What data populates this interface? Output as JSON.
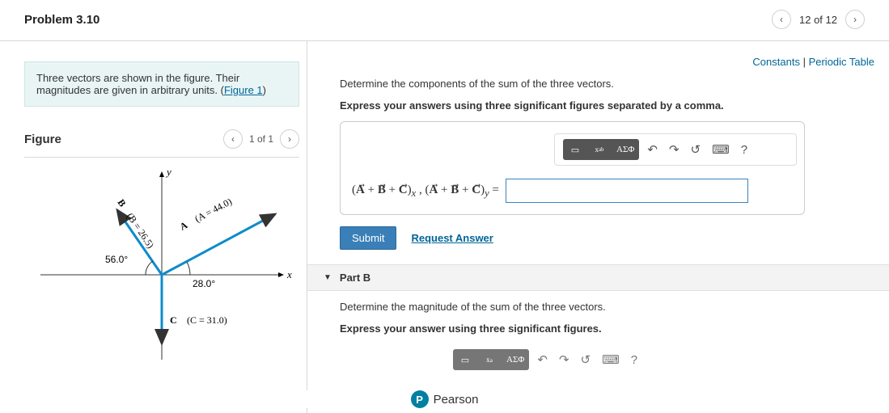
{
  "header": {
    "title": "Problem 3.10",
    "nav_count": "12 of 12"
  },
  "left": {
    "prompt_a": "Three vectors are shown in the figure. Their magnitudes are given in arbitrary units. (",
    "prompt_link": "Figure 1",
    "prompt_b": ")",
    "figure_title": "Figure",
    "figure_nav": "1 of 1"
  },
  "links": {
    "constants": "Constants",
    "sep": " | ",
    "periodic": "Periodic Table"
  },
  "partA": {
    "question": "Determine the components of the sum of the three vectors.",
    "instruction": "Express your answers using three significant figures separated by a comma.",
    "eq_label": "(A⃗ + B⃗ + C⃗)ₓ , (A⃗ + B⃗ + C⃗)ᵧ =",
    "submit": "Submit",
    "request": "Request Answer",
    "tool_greek": "ΑΣΦ"
  },
  "partB": {
    "title": "Part B",
    "question": "Determine the magnitude of the sum of the three vectors.",
    "instruction": "Express your answer using three significant figures."
  },
  "footer": {
    "brand": "Pearson"
  },
  "chart_data": {
    "type": "vector-diagram",
    "axes": [
      "x",
      "y"
    ],
    "vectors": [
      {
        "name": "A",
        "magnitude": 44.0,
        "angle_deg_from_x": 28.0,
        "label": "A⃗ (A = 44.0)"
      },
      {
        "name": "B",
        "magnitude": 26.5,
        "angle_deg_from_x": 124.0,
        "label": "B⃗ (B = 26.5)",
        "angle_label": "56.0°"
      },
      {
        "name": "C",
        "magnitude": 31.0,
        "angle_deg_from_x": 270.0,
        "label": "C⃗ (C = 31.0)"
      }
    ],
    "angle_annotations": [
      "56.0°",
      "28.0°"
    ]
  }
}
